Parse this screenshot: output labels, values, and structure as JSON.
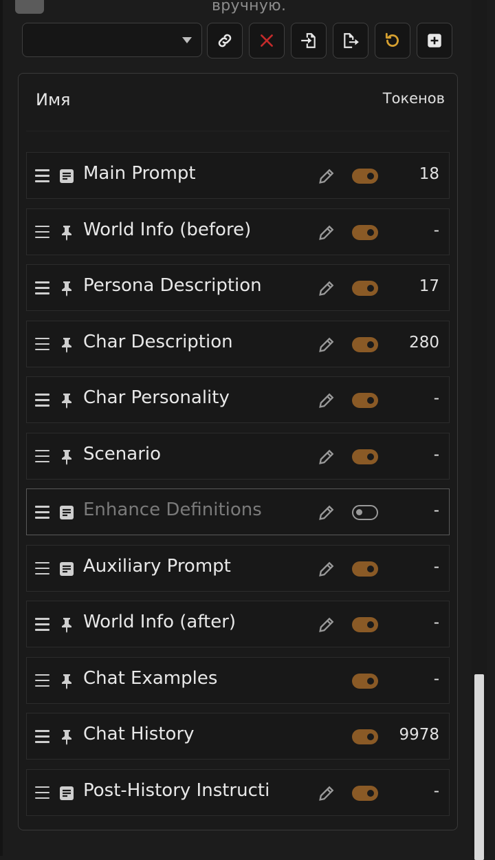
{
  "header": {
    "hint_text": "вручную.",
    "select_value": ""
  },
  "toolbar": {
    "buttons": [
      {
        "name": "link-icon",
        "color": "#e6e6e6"
      },
      {
        "name": "close-icon",
        "color": "#c42b2b"
      },
      {
        "name": "import-icon",
        "color": "#e6e6e6"
      },
      {
        "name": "export-icon",
        "color": "#e6e6e6"
      },
      {
        "name": "reset-icon",
        "color": "#d6a030"
      },
      {
        "name": "add-icon",
        "color": "#e6e6e6"
      }
    ]
  },
  "table": {
    "col_name": "Имя",
    "col_tokens": "Токенов"
  },
  "colors": {
    "toggle_on": "#8a5a26",
    "toggle_off": "#9a9a9a",
    "accent_red": "#c42b2b",
    "accent_gold": "#d6a030"
  },
  "prompts": [
    {
      "name": "Main Prompt",
      "type_icon": "text-icon",
      "editable": true,
      "enabled": true,
      "tokens": "18"
    },
    {
      "name": "World Info (before)",
      "type_icon": "pin-icon",
      "editable": true,
      "enabled": true,
      "tokens": "-"
    },
    {
      "name": "Persona Description",
      "type_icon": "pin-icon",
      "editable": true,
      "enabled": true,
      "tokens": "17"
    },
    {
      "name": "Char Description",
      "type_icon": "pin-icon",
      "editable": true,
      "enabled": true,
      "tokens": "280"
    },
    {
      "name": "Char Personality",
      "type_icon": "pin-icon",
      "editable": true,
      "enabled": true,
      "tokens": "-"
    },
    {
      "name": "Scenario",
      "type_icon": "pin-icon",
      "editable": true,
      "enabled": true,
      "tokens": "-"
    },
    {
      "name": "Enhance Definitions",
      "type_icon": "text-icon",
      "editable": true,
      "enabled": false,
      "tokens": "-"
    },
    {
      "name": "Auxiliary Prompt",
      "type_icon": "text-icon",
      "editable": true,
      "enabled": true,
      "tokens": "-"
    },
    {
      "name": "World Info (after)",
      "type_icon": "pin-icon",
      "editable": true,
      "enabled": true,
      "tokens": "-"
    },
    {
      "name": "Chat Examples",
      "type_icon": "pin-icon",
      "editable": false,
      "enabled": true,
      "tokens": "-"
    },
    {
      "name": "Chat History",
      "type_icon": "pin-icon",
      "editable": false,
      "enabled": true,
      "tokens": "9978"
    },
    {
      "name": "Post-History Instructi",
      "type_icon": "text-icon",
      "editable": true,
      "enabled": true,
      "tokens": "-"
    }
  ]
}
